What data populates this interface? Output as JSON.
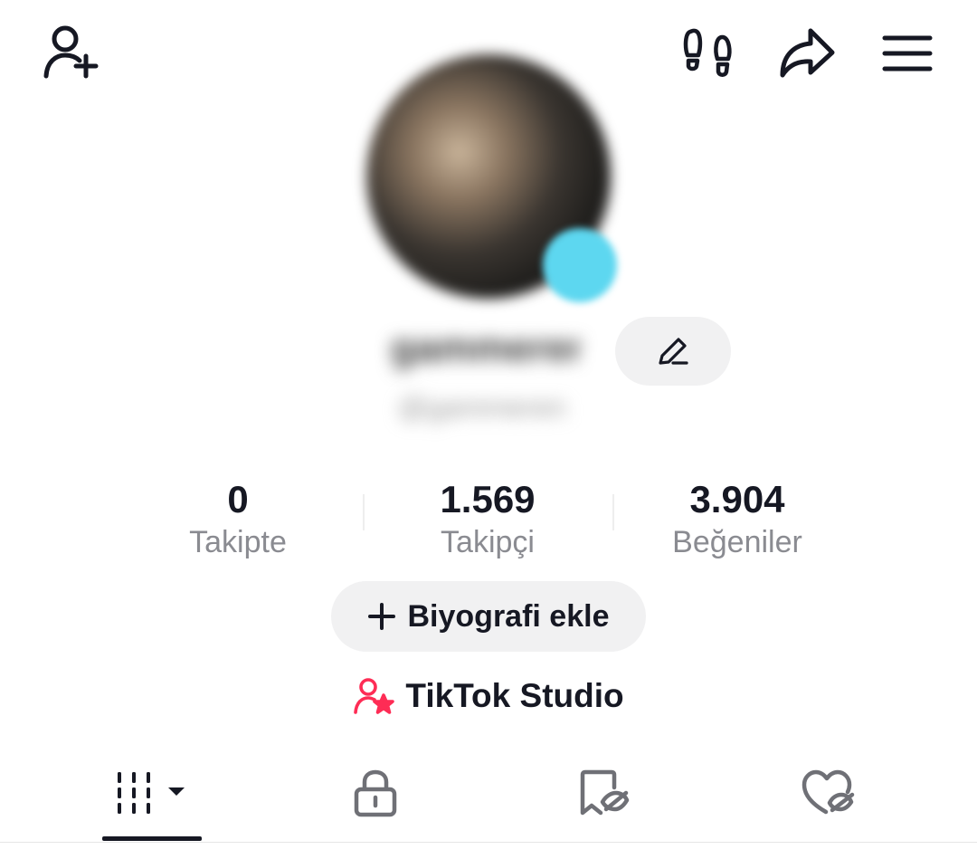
{
  "header": {
    "left_icon": "add-user-icon",
    "right_icons": [
      "footprints-icon",
      "share-icon",
      "menu-icon"
    ]
  },
  "profile": {
    "display_name": "gammeren",
    "handle": "@gammeren",
    "edit_icon": "pencil-icon",
    "badge_color": "#5dd7f0"
  },
  "stats": [
    {
      "value": "0",
      "label": "Takipte"
    },
    {
      "value": "1.569",
      "label": "Takipçi"
    },
    {
      "value": "3.904",
      "label": "Beğeniler"
    }
  ],
  "bio_button": {
    "label": "Biyografi ekle",
    "icon": "plus-icon"
  },
  "studio": {
    "label": "TikTok Studio",
    "icon": "creator-star-icon",
    "icon_color": "#fe2c55"
  },
  "tabs": [
    {
      "id": "videos",
      "icon": "grid-bars-icon",
      "active": true
    },
    {
      "id": "private",
      "icon": "lock-icon",
      "active": false
    },
    {
      "id": "favorites",
      "icon": "bookmark-hidden-icon",
      "active": false
    },
    {
      "id": "liked",
      "icon": "heart-hidden-icon",
      "active": false
    }
  ]
}
